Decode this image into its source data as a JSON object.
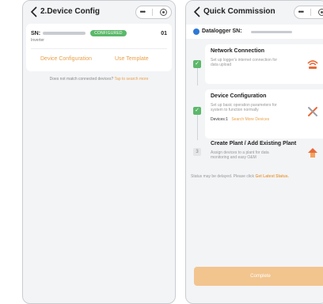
{
  "left_screen": {
    "title": "2.Device Config",
    "device": {
      "sn_label": "SN:",
      "status_badge": "CONFIGURED",
      "count": "01",
      "type": "Inverter"
    },
    "links": {
      "device_configuration": "Device Configuration",
      "use_template": "Use Template"
    },
    "hint": {
      "text": "Does not match connected devices?",
      "link": "Tap to search more"
    }
  },
  "right_screen": {
    "title": "Quick Commission",
    "datalogger_label": "Datalogger SN:",
    "steps": [
      {
        "title": "Network Connection",
        "description": "Set up logger's internet connection for data upload",
        "state": "done"
      },
      {
        "title": "Device Configuration",
        "description": "Set up basic operation parameters for system to function normally",
        "extra_label": "Devices:1",
        "extra_link": "Search More Devices",
        "state": "done"
      },
      {
        "number": "3",
        "title": "Create Plant / Add Existing Plant",
        "description": "Assign devices to a plant for data monitoring and easy O&M",
        "state": "pending"
      }
    ],
    "status_note": "Status may be delayed. Please click",
    "status_link": "Get Latest Status.",
    "complete_label": "Complete"
  },
  "colors": {
    "accent_orange": "#e9a04a",
    "success_green": "#5bb86a",
    "brand_blue": "#2e78d6",
    "button_disabled": "#f2c48e"
  },
  "icons": {
    "back": "chevron-left-icon",
    "more": "more-dots-icon",
    "close": "circle-close-icon",
    "check": "check-icon",
    "network": "wifi-router-icon",
    "tools": "wrench-screwdriver-icon",
    "plant": "house-plant-icon",
    "chevron": "chevron-right-icon"
  }
}
